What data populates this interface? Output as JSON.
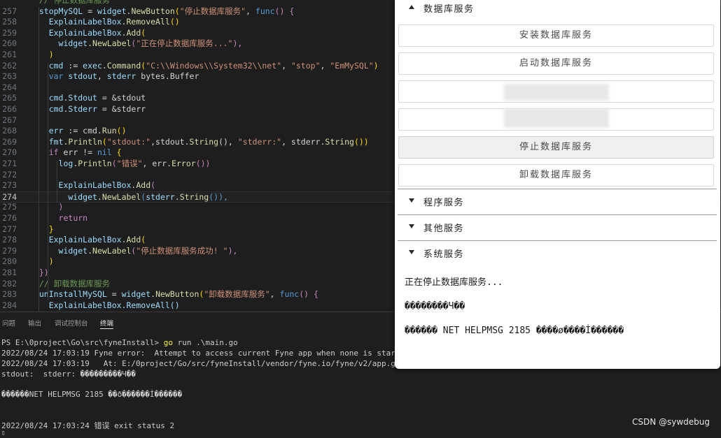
{
  "editor": {
    "current_line": 274,
    "lines": [
      {
        "n": "",
        "segs": [
          {
            "t": "  // 停止数据库服务",
            "c": "c-cm"
          }
        ]
      },
      {
        "n": "257",
        "segs": [
          {
            "t": "  ",
            "c": "c-pl"
          },
          {
            "t": "stopMySQL",
            "c": "c-id"
          },
          {
            "t": " = ",
            "c": "c-pl"
          },
          {
            "t": "widget",
            "c": "c-id"
          },
          {
            "t": ".",
            "c": "c-pl"
          },
          {
            "t": "NewButton",
            "c": "c-fn"
          },
          {
            "t": "(",
            "c": "c-br"
          },
          {
            "t": "\"停止数据库服务\"",
            "c": "c-str"
          },
          {
            "t": ", ",
            "c": "c-pl"
          },
          {
            "t": "func",
            "c": "c-kw"
          },
          {
            "t": "() {",
            "c": "c-ctl"
          }
        ]
      },
      {
        "n": "258",
        "segs": [
          {
            "t": "    ExplainLabelBox",
            "c": "c-id"
          },
          {
            "t": ".",
            "c": "c-pl"
          },
          {
            "t": "RemoveAll",
            "c": "c-fn"
          },
          {
            "t": "()",
            "c": "c-br"
          }
        ]
      },
      {
        "n": "259",
        "segs": [
          {
            "t": "    ExplainLabelBox",
            "c": "c-id"
          },
          {
            "t": ".",
            "c": "c-pl"
          },
          {
            "t": "Add",
            "c": "c-fn"
          },
          {
            "t": "(",
            "c": "c-br"
          }
        ]
      },
      {
        "n": "260",
        "segs": [
          {
            "t": "      widget",
            "c": "c-id"
          },
          {
            "t": ".",
            "c": "c-pl"
          },
          {
            "t": "NewLabel",
            "c": "c-fn"
          },
          {
            "t": "(",
            "c": "c-ctl"
          },
          {
            "t": "\"正在停止数据库服务...\"",
            "c": "c-str"
          },
          {
            "t": "),",
            "c": "c-ctl"
          }
        ]
      },
      {
        "n": "261",
        "segs": [
          {
            "t": "    )",
            "c": "c-br"
          }
        ]
      },
      {
        "n": "262",
        "segs": [
          {
            "t": "    cmd",
            "c": "c-id"
          },
          {
            "t": " := ",
            "c": "c-pl"
          },
          {
            "t": "exec",
            "c": "c-id"
          },
          {
            "t": ".",
            "c": "c-pl"
          },
          {
            "t": "Command",
            "c": "c-fn"
          },
          {
            "t": "(",
            "c": "c-br"
          },
          {
            "t": "\"C:\\\\Windows\\\\System32\\\\net\"",
            "c": "c-str"
          },
          {
            "t": ", ",
            "c": "c-pl"
          },
          {
            "t": "\"stop\"",
            "c": "c-str"
          },
          {
            "t": ", ",
            "c": "c-pl"
          },
          {
            "t": "\"EmMySQL\"",
            "c": "c-str"
          },
          {
            "t": ")",
            "c": "c-br"
          }
        ]
      },
      {
        "n": "263",
        "segs": [
          {
            "t": "    ",
            "c": "c-pl"
          },
          {
            "t": "var",
            "c": "c-kw"
          },
          {
            "t": " stdout",
            "c": "c-id"
          },
          {
            "t": ", ",
            "c": "c-pl"
          },
          {
            "t": "stderr",
            "c": "c-id"
          },
          {
            "t": " bytes.Buffer",
            "c": "c-pl"
          }
        ]
      },
      {
        "n": "264",
        "segs": []
      },
      {
        "n": "265",
        "segs": [
          {
            "t": "    cmd",
            "c": "c-id"
          },
          {
            "t": ".",
            "c": "c-pl"
          },
          {
            "t": "Stdout",
            "c": "c-id"
          },
          {
            "t": " = &stdout",
            "c": "c-pl"
          }
        ]
      },
      {
        "n": "266",
        "segs": [
          {
            "t": "    cmd",
            "c": "c-id"
          },
          {
            "t": ".",
            "c": "c-pl"
          },
          {
            "t": "Stderr",
            "c": "c-id"
          },
          {
            "t": " = &stderr",
            "c": "c-pl"
          }
        ]
      },
      {
        "n": "267",
        "segs": []
      },
      {
        "n": "268",
        "segs": [
          {
            "t": "    err",
            "c": "c-id"
          },
          {
            "t": " := cmd.",
            "c": "c-pl"
          },
          {
            "t": "Run",
            "c": "c-fn"
          },
          {
            "t": "()",
            "c": "c-br"
          }
        ]
      },
      {
        "n": "269",
        "segs": [
          {
            "t": "    fmt",
            "c": "c-id"
          },
          {
            "t": ".",
            "c": "c-pl"
          },
          {
            "t": "Println",
            "c": "c-fn"
          },
          {
            "t": "(",
            "c": "c-br"
          },
          {
            "t": "\"stdout:\"",
            "c": "c-str"
          },
          {
            "t": ",stdout.",
            "c": "c-pl"
          },
          {
            "t": "String",
            "c": "c-fn"
          },
          {
            "t": "(), ",
            "c": "c-pl"
          },
          {
            "t": "\"stderr:\"",
            "c": "c-str"
          },
          {
            "t": ", stderr.",
            "c": "c-pl"
          },
          {
            "t": "String",
            "c": "c-fn"
          },
          {
            "t": "())",
            "c": "c-br"
          }
        ]
      },
      {
        "n": "270",
        "segs": [
          {
            "t": "    ",
            "c": "c-pl"
          },
          {
            "t": "if",
            "c": "c-ctl"
          },
          {
            "t": " err != ",
            "c": "c-pl"
          },
          {
            "t": "nil",
            "c": "c-kw"
          },
          {
            "t": " {",
            "c": "c-br"
          }
        ]
      },
      {
        "n": "271",
        "segs": [
          {
            "t": "      log",
            "c": "c-id"
          },
          {
            "t": ".",
            "c": "c-pl"
          },
          {
            "t": "Println",
            "c": "c-fn"
          },
          {
            "t": "(",
            "c": "c-ctl"
          },
          {
            "t": "\"错误\"",
            "c": "c-str"
          },
          {
            "t": ", err.",
            "c": "c-pl"
          },
          {
            "t": "Error",
            "c": "c-fn"
          },
          {
            "t": "())",
            "c": "c-ctl"
          }
        ]
      },
      {
        "n": "272",
        "segs": []
      },
      {
        "n": "273",
        "segs": [
          {
            "t": "      ExplainLabelBox",
            "c": "c-id"
          },
          {
            "t": ".",
            "c": "c-pl"
          },
          {
            "t": "Add",
            "c": "c-fn"
          },
          {
            "t": "(",
            "c": "c-ctl"
          }
        ]
      },
      {
        "n": "274",
        "segs": [
          {
            "t": "        widget",
            "c": "c-id"
          },
          {
            "t": ".",
            "c": "c-pl"
          },
          {
            "t": "NewLabel",
            "c": "c-fn"
          },
          {
            "t": "(",
            "c": "c-kw"
          },
          {
            "t": "stderr",
            "c": "c-id"
          },
          {
            "t": ".",
            "c": "c-pl"
          },
          {
            "t": "String",
            "c": "c-fn"
          },
          {
            "t": "()),",
            "c": "c-kw"
          }
        ]
      },
      {
        "n": "275",
        "segs": [
          {
            "t": "      )",
            "c": "c-ctl"
          }
        ]
      },
      {
        "n": "276",
        "segs": [
          {
            "t": "      ",
            "c": "c-pl"
          },
          {
            "t": "return",
            "c": "c-ctl"
          }
        ]
      },
      {
        "n": "277",
        "segs": [
          {
            "t": "    }",
            "c": "c-br"
          }
        ]
      },
      {
        "n": "278",
        "segs": [
          {
            "t": "    ExplainLabelBox",
            "c": "c-id"
          },
          {
            "t": ".",
            "c": "c-pl"
          },
          {
            "t": "Add",
            "c": "c-fn"
          },
          {
            "t": "(",
            "c": "c-br"
          }
        ]
      },
      {
        "n": "279",
        "segs": [
          {
            "t": "      widget",
            "c": "c-id"
          },
          {
            "t": ".",
            "c": "c-pl"
          },
          {
            "t": "NewLabel",
            "c": "c-fn"
          },
          {
            "t": "(",
            "c": "c-ctl"
          },
          {
            "t": "\"停止数据库服务成功! \"",
            "c": "c-str"
          },
          {
            "t": "),",
            "c": "c-ctl"
          }
        ]
      },
      {
        "n": "280",
        "segs": [
          {
            "t": "    )",
            "c": "c-br"
          }
        ]
      },
      {
        "n": "281",
        "segs": [
          {
            "t": "  })",
            "c": "c-ctl"
          }
        ]
      },
      {
        "n": "282",
        "segs": [
          {
            "t": "  // 卸载数据库服务",
            "c": "c-cm"
          }
        ]
      },
      {
        "n": "283",
        "segs": [
          {
            "t": "  ",
            "c": "c-pl"
          },
          {
            "t": "unInstallMySQL",
            "c": "c-id"
          },
          {
            "t": " = ",
            "c": "c-pl"
          },
          {
            "t": "widget",
            "c": "c-id"
          },
          {
            "t": ".",
            "c": "c-pl"
          },
          {
            "t": "NewButton",
            "c": "c-fn"
          },
          {
            "t": "(",
            "c": "c-br"
          },
          {
            "t": "\"卸载数据库服务\"",
            "c": "c-str"
          },
          {
            "t": ", ",
            "c": "c-pl"
          },
          {
            "t": "func",
            "c": "c-kw"
          },
          {
            "t": "() {",
            "c": "c-ctl"
          }
        ]
      },
      {
        "n": "284",
        "segs": [
          {
            "t": "    ExplainLabelBox.RemoveAll()",
            "c": "c-id"
          }
        ]
      }
    ]
  },
  "panel": {
    "tabs": [
      {
        "label": "问题",
        "active": false
      },
      {
        "label": "输出",
        "active": false
      },
      {
        "label": "调试控制台",
        "active": false
      },
      {
        "label": "终端",
        "active": true
      }
    ]
  },
  "terminal": {
    "prompt": "PS E:\\0project\\Go\\src\\fyneInstall> ",
    "cmd_go": "go",
    "cmd_rest": " run .\\main.go",
    "log1": "2022/08/24 17:03:19 Fyne error:  Attempt to access current Fyne app when none is started",
    "log2": "2022/08/24 17:03:19   At: E:/0project/Go/src/fyneInstall/vendor/fyne.io/fyne/v2/app.go:92",
    "log3": "stdout:  stderr: ���������Ч��",
    "log4": "������NET HELPMSG 2185 ��ð������İ������",
    "log5": "2022/08/24 17:03:24 错误 exit status 2",
    "cursor": "▯"
  },
  "fyne": {
    "section_db": "数据库服务",
    "buttons": [
      "安装数据库服务",
      "启动数据库服务",
      "",
      "",
      "停止数据库服务",
      "卸载数据库服务"
    ],
    "section_prog": "程序服务",
    "section_other": "其他服务",
    "section_sys": "系统服务",
    "output": [
      "正在停止数据库服务...",
      "��������Ч��",
      "������ NET HELPMSG 2185 ����ø����İ������"
    ]
  },
  "watermark": "CSDN @sywdebug"
}
